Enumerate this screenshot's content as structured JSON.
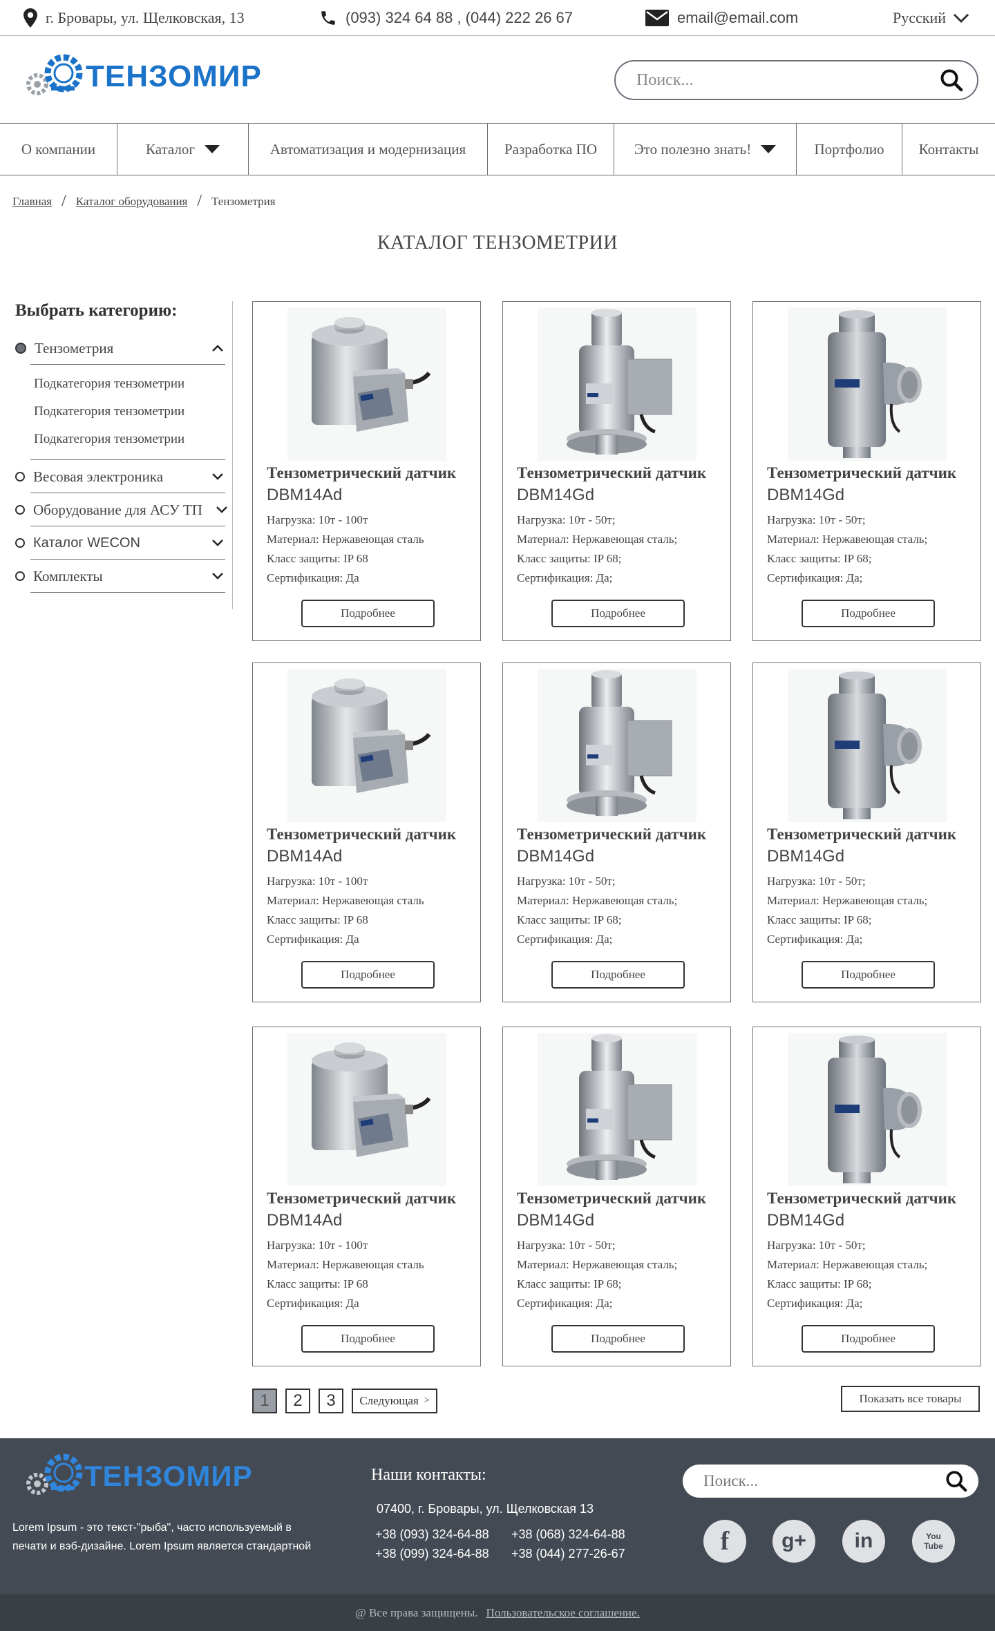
{
  "topbar": {
    "address": "г. Бровары, ул. Щелковская, 13",
    "phones": "(093) 324 64 88 , (044) 222 26 67",
    "email": "email@email.com",
    "language": "Русский"
  },
  "header": {
    "logo_text": "ТЕНЗОМИР",
    "search_placeholder": "Поиск..."
  },
  "nav": [
    {
      "label": "О компании"
    },
    {
      "label": "Каталог"
    },
    {
      "label": "Автоматизация и модернизация"
    },
    {
      "label": "Разработка ПО"
    },
    {
      "label": "Это полезно знать!"
    },
    {
      "label": "Портфолио"
    },
    {
      "label": "Контакты"
    }
  ],
  "breadcrumb": [
    "Главная",
    "Каталог оборудования",
    "Тензометрия"
  ],
  "page_title": "КАТАЛОГ ТЕНЗОМЕТРИИ",
  "sidebar": {
    "heading": "Выбрать категорию:",
    "active_category": "Тензометрия",
    "subcategories": [
      "Подкатегория тензометрии",
      "Подкатегория тензометрии",
      "Подкатегория тензометрии"
    ],
    "categories": [
      "Весовая электроника",
      "Оборудование для АСУ ТП",
      "Каталог WECON",
      "Комплекты"
    ]
  },
  "products": [
    {
      "name": "Тензометрический датчик",
      "model": "DBM14Ad",
      "load": "Нагрузка: 10т - 100т",
      "material": "Материал: Нержавеющая сталь",
      "protection": "Класс защиты: IP 68",
      "cert": "Сертификация: Да",
      "button": "Подробнее",
      "image": "load-cell-short"
    },
    {
      "name": "Тензометрический датчик",
      "model": "DBM14Gd",
      "load": "Нагрузка: 10т - 50т;",
      "material": "Материал: Нержавеющая сталь;",
      "protection": "Класс защиты: IP 68;",
      "cert": "Сертификация: Да;",
      "button": "Подробнее",
      "image": "load-cell-column"
    },
    {
      "name": "Тензометрический датчик",
      "model": "DBM14Gd",
      "load": "Нагрузка: 10т - 50т;",
      "material": "Материал: Нержавеющая сталь;",
      "protection": "Класс защиты: IP 68;",
      "cert": "Сертификация: Да;",
      "button": "Подробнее",
      "image": "load-cell-tall"
    },
    {
      "name": "Тензометрический датчик",
      "model": "DBM14Ad",
      "load": "Нагрузка: 10т - 100т",
      "material": "Материал: Нержавеющая сталь",
      "protection": "Класс защиты: IP 68",
      "cert": "Сертификация: Да",
      "button": "Подробнее",
      "image": "load-cell-short"
    },
    {
      "name": "Тензометрический датчик",
      "model": "DBM14Gd",
      "load": "Нагрузка: 10т - 50т;",
      "material": "Материал: Нержавеющая сталь;",
      "protection": "Класс защиты: IP 68;",
      "cert": "Сертификация: Да;",
      "button": "Подробнее",
      "image": "load-cell-column"
    },
    {
      "name": "Тензометрический датчик",
      "model": "DBM14Gd",
      "load": "Нагрузка: 10т - 50т;",
      "material": "Материал: Нержавеющая сталь;",
      "protection": "Класс защиты: IP 68;",
      "cert": "Сертификация: Да;",
      "button": "Подробнее",
      "image": "load-cell-tall"
    },
    {
      "name": "Тензометрический датчик",
      "model": "DBM14Ad",
      "load": "Нагрузка: 10т - 100т",
      "material": "Материал: Нержавеющая сталь",
      "protection": "Класс защиты: IP 68",
      "cert": "Сертификация: Да",
      "button": "Подробнее",
      "image": "load-cell-short"
    },
    {
      "name": "Тензометрический датчик",
      "model": "DBM14Gd",
      "load": "Нагрузка: 10т - 50т;",
      "material": "Материал: Нержавеющая сталь;",
      "protection": "Класс защиты: IP 68;",
      "cert": "Сертификация: Да;",
      "button": "Подробнее",
      "image": "load-cell-column"
    },
    {
      "name": "Тензометрический датчик",
      "model": "DBM14Gd",
      "load": "Нагрузка: 10т - 50т;",
      "material": "Материал: Нержавеющая сталь;",
      "protection": "Класс защиты: IP 68;",
      "cert": "Сертификация: Да;",
      "button": "Подробнее",
      "image": "load-cell-tall"
    }
  ],
  "pagination": {
    "pages": [
      "1",
      "2",
      "3"
    ],
    "current": "1",
    "next_label": "Следующая",
    "next_arrow": ">",
    "show_all": "Показать все товары"
  },
  "footer": {
    "logo_text": "ТЕНЗОМИР",
    "description_line1": "Lorem Ipsum - это текст-\"рыба\", часто используемый в",
    "description_line2": "печати и вэб-дизайне. Lorem Ipsum является стандартной",
    "contacts_title": "Наши контакты:",
    "address": "07400, г. Бровары, ул. Щелковская 13",
    "phones": [
      "+38 (093) 324-64-88",
      "+38 (068) 324-64-88",
      "+38 (099) 324-64-88",
      "+38 (044) 277-26-67"
    ],
    "search_placeholder": "Поиск...",
    "social": [
      {
        "name": "facebook-icon",
        "glyph": "f"
      },
      {
        "name": "google-plus-icon",
        "glyph": "g+"
      },
      {
        "name": "linkedin-icon",
        "glyph": "in"
      },
      {
        "name": "youtube-icon",
        "glyph": "You Tube"
      }
    ]
  },
  "copyright": {
    "text": "@ Все права защищены.",
    "link": "Пользовательское соглашение."
  },
  "colors": {
    "accent_blue": "#1a73c9",
    "dark_gray": "#444a53",
    "border": "#6d7079"
  }
}
